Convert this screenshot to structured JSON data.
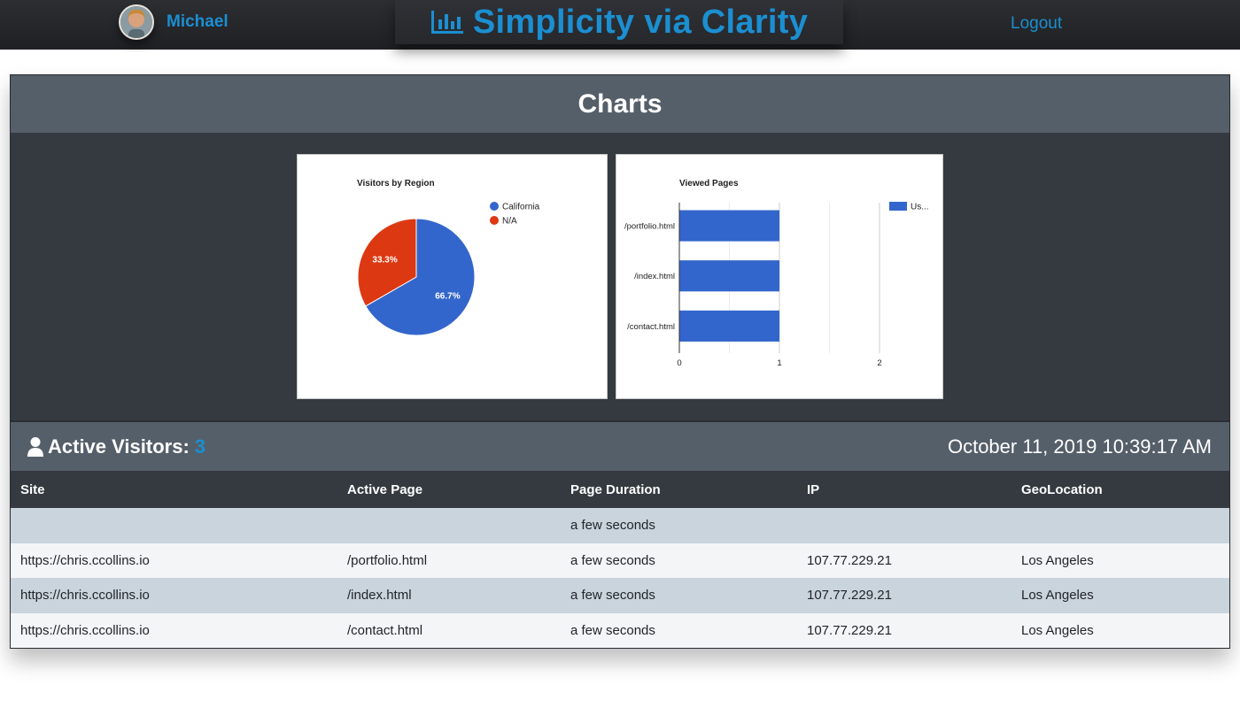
{
  "header": {
    "username": "Michael",
    "brand_title": "Simplicity via Clarity",
    "logout_label": "Logout",
    "accent_color": "#1b8fd1"
  },
  "charts_section": {
    "title": "Charts"
  },
  "pie_chart": {
    "chart_data": {
      "type": "pie",
      "title": "Visitors by Region",
      "slices": [
        {
          "label": "California",
          "value": 66.7,
          "display": "66.7%",
          "color": "#3366cc"
        },
        {
          "label": "N/A",
          "value": 33.3,
          "display": "33.3%",
          "color": "#dc3912"
        }
      ],
      "legend_position": "right"
    }
  },
  "bar_chart": {
    "chart_data": {
      "type": "bar",
      "orientation": "horizontal",
      "title": "Viewed Pages",
      "categories": [
        "/portfolio.html",
        "/index.html",
        "/contact.html"
      ],
      "series": [
        {
          "name": "Us...",
          "values": [
            1,
            1,
            1
          ],
          "color": "#3366cc"
        }
      ],
      "xlim": [
        0,
        2
      ],
      "xticks": [
        "0",
        "1",
        "2"
      ],
      "grid": true,
      "legend_position": "top-right"
    }
  },
  "visitors": {
    "label": "Active Visitors:",
    "count": "3",
    "datetime": "October 11, 2019 10:39:17 AM"
  },
  "table": {
    "columns": [
      "Site",
      "Active Page",
      "Page Duration",
      "IP",
      "GeoLocation"
    ],
    "rows": [
      [
        "",
        "",
        "a few seconds",
        "",
        ""
      ],
      [
        "https://chris.ccollins.io",
        "/portfolio.html",
        "a few seconds",
        "107.77.229.21",
        "Los Angeles"
      ],
      [
        "https://chris.ccollins.io",
        "/index.html",
        "a few seconds",
        "107.77.229.21",
        "Los Angeles"
      ],
      [
        "https://chris.ccollins.io",
        "/contact.html",
        "a few seconds",
        "107.77.229.21",
        "Los Angeles"
      ]
    ]
  }
}
